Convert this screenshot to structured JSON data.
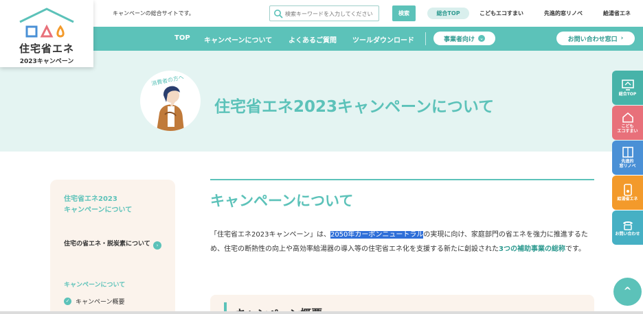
{
  "brand": {
    "logo_title": "住宅省エネ",
    "logo_sub": "2023キャンペーン",
    "tagline": "キャンペーンの総合サイトです。",
    "accent": "#5cc2b9"
  },
  "topbar": {
    "search_placeholder": "検索キーワードを入力してください",
    "search_button": "検索",
    "pill": "総合TOP",
    "links": [
      "こどもエコすまい",
      "先進的窓リノベ",
      "給湯省エネ"
    ]
  },
  "nav": {
    "items": [
      "TOP",
      "キャンペーンについて",
      "よくあるご質問",
      "ツールダウンロード"
    ],
    "business_button": "事業者向け",
    "contact_button": "お問い合わせ窓口"
  },
  "hero": {
    "label": "消費者の方へ",
    "title": "住宅省エネ2023キャンペーンについて"
  },
  "side_nav": {
    "items": [
      {
        "label": "総合TOP",
        "color": "#47b3a9",
        "icon": "house-icon"
      },
      {
        "label": "こども\nエコすまい",
        "color": "#e8707a",
        "icon": "home-icon"
      },
      {
        "label": "先進的\n窓リノベ",
        "color": "#4a90d6",
        "icon": "window-icon"
      },
      {
        "label": "給湯省エネ",
        "color": "#f39a2b",
        "icon": "phone-icon"
      },
      {
        "label": "お問い合わせ",
        "color": "#46b0c4",
        "icon": "telephone-icon"
      }
    ]
  },
  "sidebar": {
    "title": "住宅省エネ2023\nキャンペーンについて",
    "link": "住宅の省エネ・脱炭素について",
    "section": "キャンペーンについて",
    "sub": "キャンペーン概要"
  },
  "main": {
    "title": "キャンペーンについて",
    "p_a": "「住宅省エネ2023キャンペーン」は、",
    "p_highlight": "2050年カーボンニュートラル",
    "p_b": "の実現に向け、家庭部門の省エネを強力に推進するため、住宅の断熱性の向上や高効率給湯器の導入等の住宅省エネ化を支援する新たに創設された",
    "p_link": "3つの補助事業の総称",
    "p_c": "です。",
    "overview_title": "キャンペーン概要"
  },
  "to_top": "^"
}
